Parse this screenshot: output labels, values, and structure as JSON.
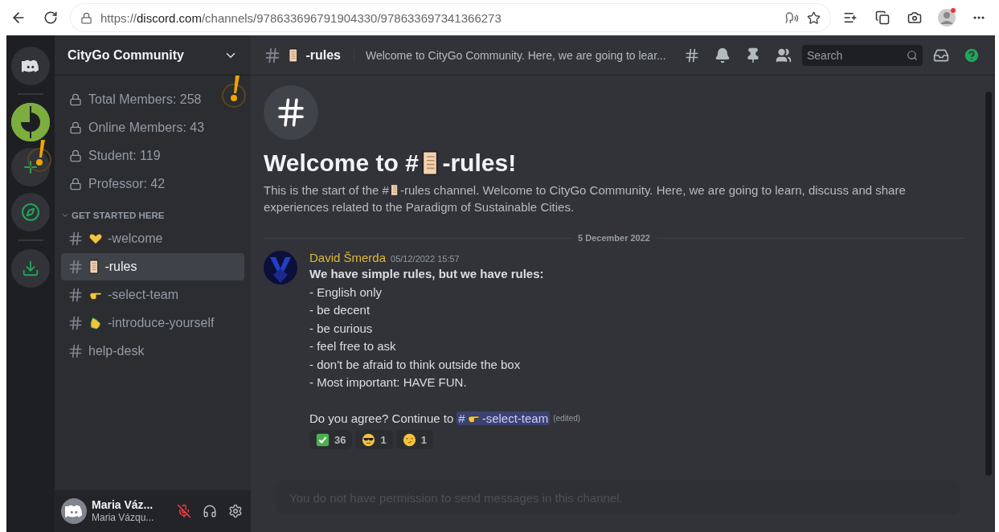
{
  "browser": {
    "url": [
      "https://",
      "discord.com",
      "/channels/978633696791904330/978633697341366273"
    ]
  },
  "sidebar": {
    "server_name": "CityGo Community",
    "stats": [
      {
        "label": "Total Members: 258"
      },
      {
        "label": "Online Members: 43"
      },
      {
        "label": "Student: 119"
      },
      {
        "label": "Professor: 42"
      }
    ],
    "category": {
      "label": "GET STARTED HERE",
      "expanded": true
    },
    "channels": [
      {
        "name": "-welcome",
        "kind": "heart",
        "selected": false
      },
      {
        "name": "-rules",
        "kind": "scroll",
        "selected": true
      },
      {
        "name": "-select-team",
        "kind": "pointing",
        "selected": false
      },
      {
        "name": "-introduce-yourself",
        "kind": "clapping",
        "selected": false
      },
      {
        "name": "help-desk",
        "kind": "plain",
        "selected": false
      }
    ]
  },
  "header": {
    "channel": "-rules",
    "topic": "Welcome to CityGo Community. Here, we are going to lear...",
    "search": {
      "placeholder": "Search"
    }
  },
  "welcome": {
    "title_before": "Welcome to #",
    "title_after": "-rules!",
    "description_before": "This is the start of the #",
    "description_after": "-rules channel. Welcome to CityGo Community. Here, we are going to learn, discuss and share",
    "description_line_2": "experiences related to the Paradigm of Sustainable Cities."
  },
  "date_divider": "5 December 2022",
  "message": {
    "author": "David Šmerda",
    "timestamp": "05/12/2022 15:57",
    "lines": [
      {
        "text": "We have simple rules, but we have rules:",
        "bold": true
      },
      {
        "text": "- English only",
        "bold": false
      },
      {
        "text": "- be decent",
        "bold": false
      },
      {
        "text": "- be curious",
        "bold": false
      },
      {
        "text": "- feel free to ask",
        "bold": false
      },
      {
        "text": "- don't be afraid to think outside the box",
        "bold": false
      },
      {
        "text": "- Most important: HAVE FUN.",
        "bold": false
      }
    ],
    "closing": "Do you agree? Continue to",
    "mention": {
      "hash": "#",
      "name": "-select-team"
    },
    "edited": "(edited)",
    "reactions": [
      {
        "kind": "check",
        "count": "36"
      },
      {
        "kind": "cool",
        "count": "1"
      },
      {
        "kind": "smirk",
        "count": "1"
      }
    ]
  },
  "composer": {
    "placeholder": "You do not have permission to send messages in this channel.",
    "disabled": true
  },
  "user": {
    "name": "Maria Váz...",
    "username": "Maria Vázqu...",
    "muted": true
  }
}
